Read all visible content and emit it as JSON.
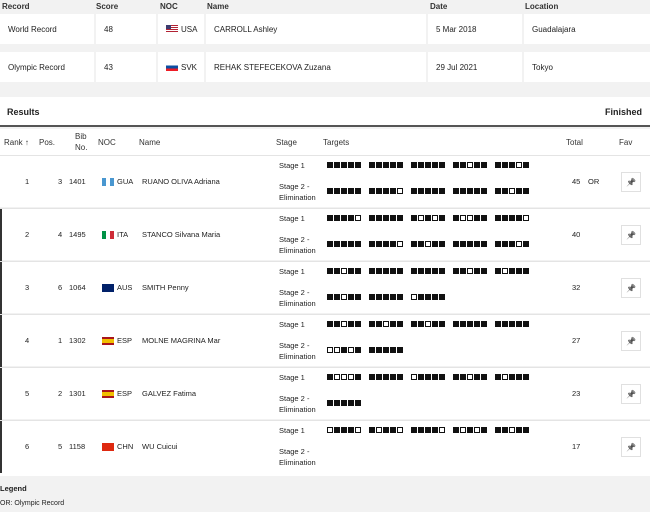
{
  "records": {
    "headers": {
      "record": "Record",
      "score": "Score",
      "noc": "NOC",
      "name": "Name",
      "date": "Date",
      "location": "Location"
    },
    "rows": [
      {
        "record": "World Record",
        "score": "48",
        "noc": "USA",
        "name": "CARROLL Ashley",
        "date": "5 Mar 2018",
        "location": "Guadalajara"
      },
      {
        "record": "Olympic Record",
        "score": "43",
        "noc": "SVK",
        "name": "REHAK STEFECEKOVA Zuzana",
        "date": "29 Jul 2021",
        "location": "Tokyo"
      }
    ]
  },
  "results": {
    "title": "Results",
    "status": "Finished",
    "headers": {
      "rank": "Rank ↑",
      "pos": "Pos.",
      "bib_1": "Bib",
      "bib_2": "No.",
      "noc": "NOC",
      "name": "Name",
      "stage": "Stage",
      "targets": "Targets",
      "total": "Total",
      "fav": "Fav"
    },
    "stage_labels": {
      "s1": "Stage 1",
      "s2a": "Stage 2 -",
      "s2b": "Elimination"
    },
    "rows": [
      {
        "rank": "1",
        "pos": "3",
        "bib": "1401",
        "noc": "GUA",
        "name": "RUANO OLIVA Adriana",
        "total": "45",
        "note": "OR",
        "s1": [
          "11111",
          "11111",
          "11111",
          "11011",
          "11101"
        ],
        "s2": [
          "11111",
          "11110",
          "11111",
          "11111",
          "11011"
        ]
      },
      {
        "rank": "2",
        "pos": "4",
        "bib": "1495",
        "noc": "ITA",
        "name": "STANCO Silvana Maria",
        "total": "40",
        "note": "",
        "s1": [
          "11110",
          "11111",
          "10101",
          "10011",
          "11110"
        ],
        "s2": [
          "11111",
          "11110",
          "11011",
          "11111",
          "11101"
        ]
      },
      {
        "rank": "3",
        "pos": "6",
        "bib": "1064",
        "noc": "AUS",
        "name": "SMITH Penny",
        "total": "32",
        "note": "",
        "s1": [
          "11011",
          "11111",
          "11111",
          "11011",
          "10111"
        ],
        "s2": [
          "11011",
          "11111",
          "01111"
        ]
      },
      {
        "rank": "4",
        "pos": "1",
        "bib": "1302",
        "noc": "ESP",
        "name": "MOLNE MAGRINA Mar",
        "total": "27",
        "note": "",
        "s1": [
          "11011",
          "11011",
          "11011",
          "11111",
          "11111"
        ],
        "s2": [
          "00101",
          "11111"
        ]
      },
      {
        "rank": "5",
        "pos": "2",
        "bib": "1301",
        "noc": "ESP",
        "name": "GALVEZ Fatima",
        "total": "23",
        "note": "",
        "s1": [
          "10001",
          "11111",
          "01111",
          "11011",
          "10111"
        ],
        "s2": [
          "11111"
        ]
      },
      {
        "rank": "6",
        "pos": "5",
        "bib": "1158",
        "noc": "CHN",
        "name": "WU Cuicui",
        "total": "17",
        "note": "",
        "s1": [
          "01110",
          "10110",
          "11110",
          "10101",
          "11011"
        ],
        "s2": []
      }
    ]
  },
  "legend": {
    "title": "Legend",
    "or": "OR:  Olympic Record"
  },
  "icons": {
    "pin": "📌"
  }
}
